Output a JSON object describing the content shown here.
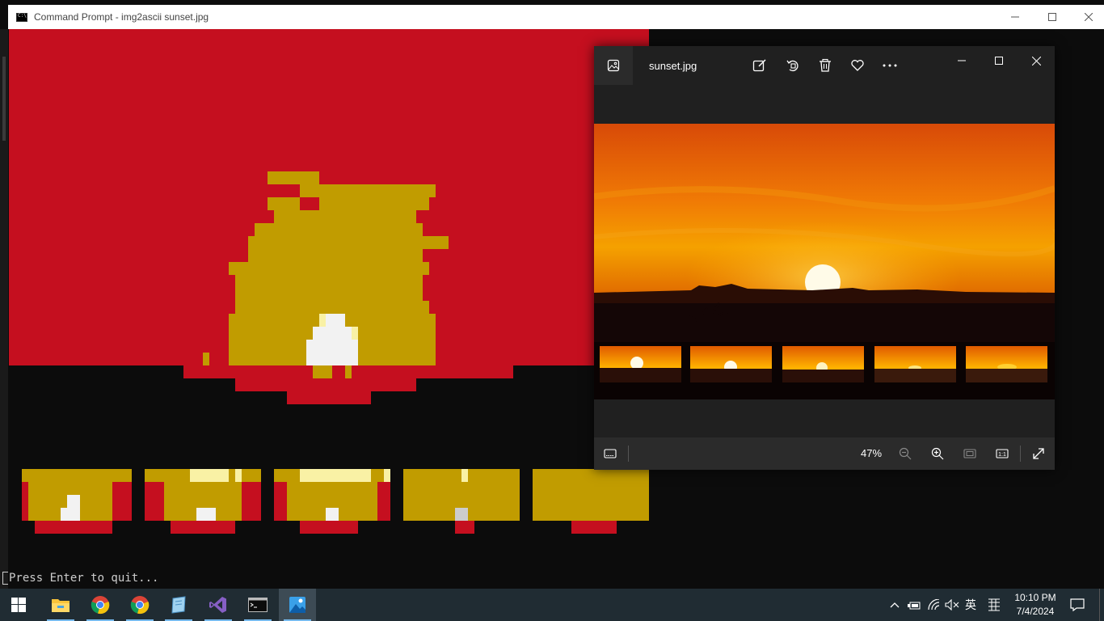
{
  "cmd_window": {
    "title": "Command Prompt - img2ascii  sunset.jpg",
    "prompt_text": "Press Enter to quit...",
    "colors": {
      "red": "#c50f1f",
      "gold": "#c19c00",
      "black": "#0c0c0c",
      "white": "#f2f2f2",
      "pale_yellow": "#f9f1a5",
      "gray": "#cccccc"
    },
    "minimize_icon": "minimize-icon",
    "maximize_icon": "maximize-icon",
    "close_icon": "close-icon"
  },
  "photos_window": {
    "filename": "sunset.jpg",
    "zoom_label": "47%",
    "toolbar": [
      "edit-icon",
      "rotate-icon",
      "delete-icon",
      "favorite-icon",
      "more-icon"
    ],
    "bottom_bar": [
      "filmstrip-icon",
      "zoom-out-icon",
      "zoom-in-icon",
      "fit-window-icon",
      "actual-size-icon",
      "fullscreen-icon"
    ],
    "sky_colors": [
      "#d84a08",
      "#f5a100"
    ],
    "thumbnail_count": 5
  },
  "taskbar": {
    "apps": [
      "start-icon",
      "file-explorer-icon",
      "chrome-icon",
      "chrome-icon",
      "notepad-icon",
      "visual-studio-icon",
      "command-prompt-icon",
      "photos-icon"
    ],
    "tray": {
      "ime_label": "英",
      "time": "10:10 PM",
      "date": "7/4/2024"
    }
  }
}
